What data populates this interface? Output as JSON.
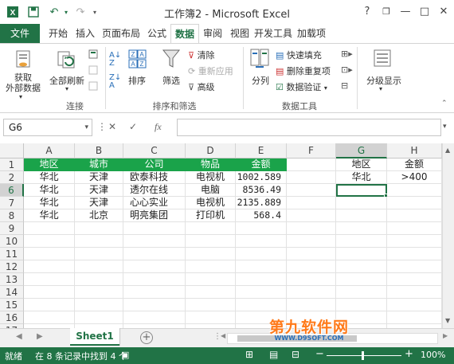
{
  "window": {
    "title": "工作簿2 - Microsoft Excel",
    "help": "?",
    "restore": "❐",
    "minimize": "—",
    "maximize": "□",
    "close": "✕"
  },
  "tabs": [
    "文件",
    "开始",
    "插入",
    "页面布局",
    "公式",
    "数据",
    "审阅",
    "视图",
    "开发工具",
    "加载项"
  ],
  "active_tab": "数据",
  "ribbon": {
    "get_external_data": "获取\n外部数据",
    "refresh_all": "全部刷新",
    "connections_group": "连接",
    "sort": "排序",
    "filter": "筛选",
    "clear": "清除",
    "reapply": "重新应用",
    "advanced": "高级",
    "sort_filter_group": "排序和筛选",
    "text_to_columns": "分列",
    "flash_fill": "快速填充",
    "remove_duplicates": "删除重复项",
    "data_validation": "数据验证",
    "data_tools_group": "数据工具",
    "outline": "分级显示"
  },
  "formula_bar": {
    "name_box": "G6",
    "fx": "fx",
    "formula": ""
  },
  "columns": [
    "A",
    "B",
    "C",
    "D",
    "E",
    "F",
    "G",
    "H"
  ],
  "selected_column": "G",
  "rows": [
    "1",
    "2",
    "6",
    "7",
    "8",
    "9",
    "10",
    "11",
    "12",
    "13",
    "14",
    "15",
    "16",
    "17"
  ],
  "selected_row": "6",
  "cells": {
    "r1": [
      "地区",
      "城市",
      "公司",
      "物品",
      "金额",
      "",
      "地区",
      "金额"
    ],
    "r2": [
      "华北",
      "天津",
      "欧泰科技",
      "电视机",
      "1002.589",
      "",
      "华北",
      ">400"
    ],
    "r6": [
      "华北",
      "天津",
      "透尔在线",
      "电脑",
      "8536.49",
      "",
      "",
      ""
    ],
    "r7": [
      "华北",
      "天津",
      "心心实业",
      "电视机",
      "2135.889",
      "",
      "",
      ""
    ],
    "r8": [
      "华北",
      "北京",
      "明亮集团",
      "打印机",
      "568.4",
      "",
      "",
      ""
    ]
  },
  "sheet_tab": "Sheet1",
  "add_sheet": "+",
  "status": {
    "ready": "就绪",
    "filter_result": "在 8 条记录中找到 4 个",
    "zoom": "100%",
    "zoom_minus": "−",
    "zoom_plus": "+"
  },
  "watermark": {
    "main": "第九软件网",
    "sub": "WWW.D9SOFT.COM"
  },
  "colors": {
    "accent": "#217346",
    "header_fill": "#1aa34a"
  }
}
